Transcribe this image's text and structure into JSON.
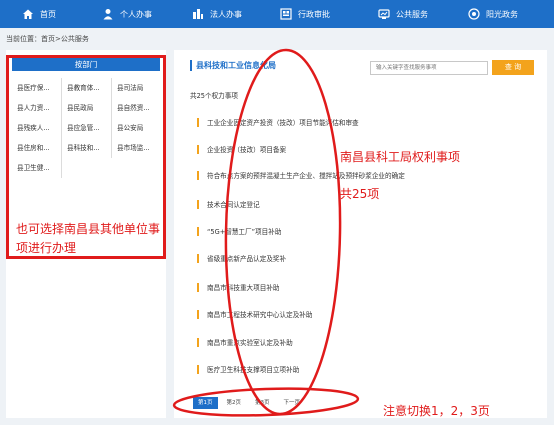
{
  "nav": [
    {
      "label": "首页",
      "icon": "home-icon"
    },
    {
      "label": "个人办事",
      "icon": "person-icon"
    },
    {
      "label": "法人办事",
      "icon": "building-icon"
    },
    {
      "label": "行政审批",
      "icon": "approval-icon"
    },
    {
      "label": "公共服务",
      "icon": "public-service-icon"
    },
    {
      "label": "阳光政务",
      "icon": "sun-icon"
    }
  ],
  "breadcrumb": "当前位置：首页>公共服务",
  "left": {
    "header": "按部门",
    "departments": [
      "县医疗保...",
      "县教育体...",
      "县司法局",
      "县人力资...",
      "县民政局",
      "县自然资...",
      "县残疾人...",
      "县应急管...",
      "县公安局",
      "县住房和...",
      "县科技和...",
      "县市场监...",
      "县卫生健..."
    ],
    "annotation": "也可选择南昌县其他单位事项进行办理"
  },
  "right": {
    "title": "县科技和工业信息化局",
    "search_placeholder": "输入关键字查找服务事项",
    "search_button": "查 询",
    "total": "共25个权力事项",
    "items": [
      "工业企业固定资产投资（技改）项目节能评估和审查",
      "企业投资（技改）项目备案",
      "符合布点方案的预拌混凝土生产企业、搅拌站及预拌砂浆企业的确定",
      "技术合同认定登记",
      "“5G+智慧工厂”项目补助",
      "省级重点新产品认定及奖补",
      "南昌市科技重大项目补助",
      "南昌市工程技术研究中心认定及补助",
      "南昌市重点实验室认定及补助",
      "医疗卫生科技支撑项目立项补助"
    ],
    "annotation_title": "南昌县科工局权利事项",
    "annotation_count": "共25项",
    "pager": [
      "第1页",
      "第2页",
      "第3页",
      "下一页"
    ],
    "annotation_pager": "注意切换1，2，3页"
  },
  "colors": {
    "primary": "#1e6fc8",
    "accent": "#f3a31c",
    "annotation": "#e01b1b"
  }
}
